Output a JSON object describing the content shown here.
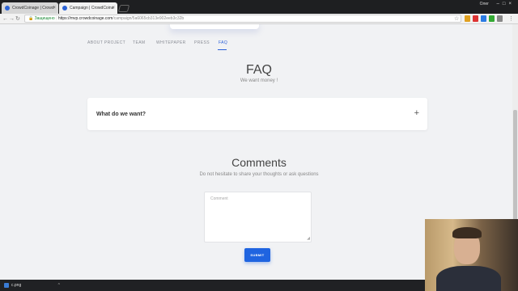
{
  "browser": {
    "tabs": [
      {
        "label": "CrowdCoinage | Crowd"
      },
      {
        "label": "Campaign | CrowdCoina"
      }
    ],
    "user_label": "Олег",
    "security_label": "Защищено",
    "url_host": "https://mvp.crowdcoinage.com",
    "url_path": "/campaign/5a6065cb313e902eeb3c32b"
  },
  "subnav": {
    "items": [
      "ABOUT PROJECT",
      "TEAM",
      "WHITEPAPER",
      "PRESS",
      "FAQ"
    ],
    "active": "FAQ"
  },
  "faq": {
    "title": "FAQ",
    "subtitle": "We want money !",
    "items": [
      {
        "question": "What do we want?",
        "toggle": "+"
      }
    ]
  },
  "comments": {
    "title": "Comments",
    "subtitle": "Do not hesitate to share your thoughts or ask questions",
    "placeholder": "Comment",
    "submit_label": "SUBMIT"
  },
  "downloads": {
    "file": "c.png"
  },
  "colors": {
    "accent": "#1f64e0",
    "background": "#f1f2f4"
  }
}
